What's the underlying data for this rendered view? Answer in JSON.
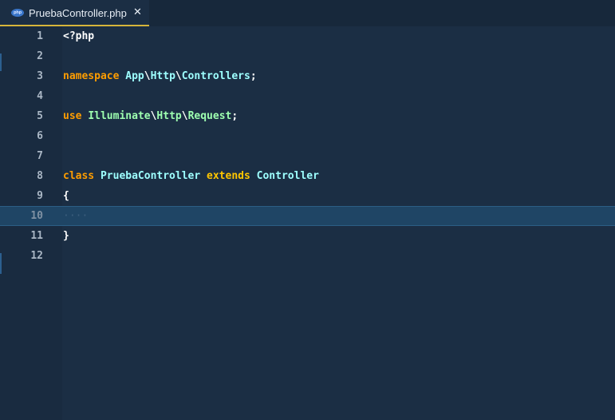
{
  "tab": {
    "icon": "php-file-icon",
    "icon_text": "php",
    "title": "PruebaController.php",
    "close": "✕"
  },
  "lines": [
    {
      "num": "1",
      "text": "<?php"
    },
    {
      "num": "2",
      "text": ""
    },
    {
      "num": "3",
      "ns_kw": "namespace",
      "ns_a": "App",
      "ns_b": "Http",
      "ns_c": "Controllers",
      "bs": "\\",
      "semi": ";"
    },
    {
      "num": "4",
      "text": ""
    },
    {
      "num": "5",
      "use_kw": "use",
      "u_a": "Illuminate",
      "u_b": "Http",
      "u_c": "Request",
      "bs": "\\",
      "semi": ";"
    },
    {
      "num": "6",
      "text": ""
    },
    {
      "num": "7",
      "text": ""
    },
    {
      "num": "8",
      "class_kw": "class",
      "class_name": "PruebaController",
      "extends_kw": "extends",
      "parent": "Controller"
    },
    {
      "num": "9",
      "text": "{"
    },
    {
      "num": "10",
      "text": "····"
    },
    {
      "num": "11",
      "text": "}"
    },
    {
      "num": "12",
      "text": ""
    }
  ],
  "colors": {
    "background": "#1b2e44",
    "keyword": "#ff9d00",
    "identifier": "#9effff",
    "class_name": "#9effb0",
    "tab_accent": "#d6b53a"
  }
}
